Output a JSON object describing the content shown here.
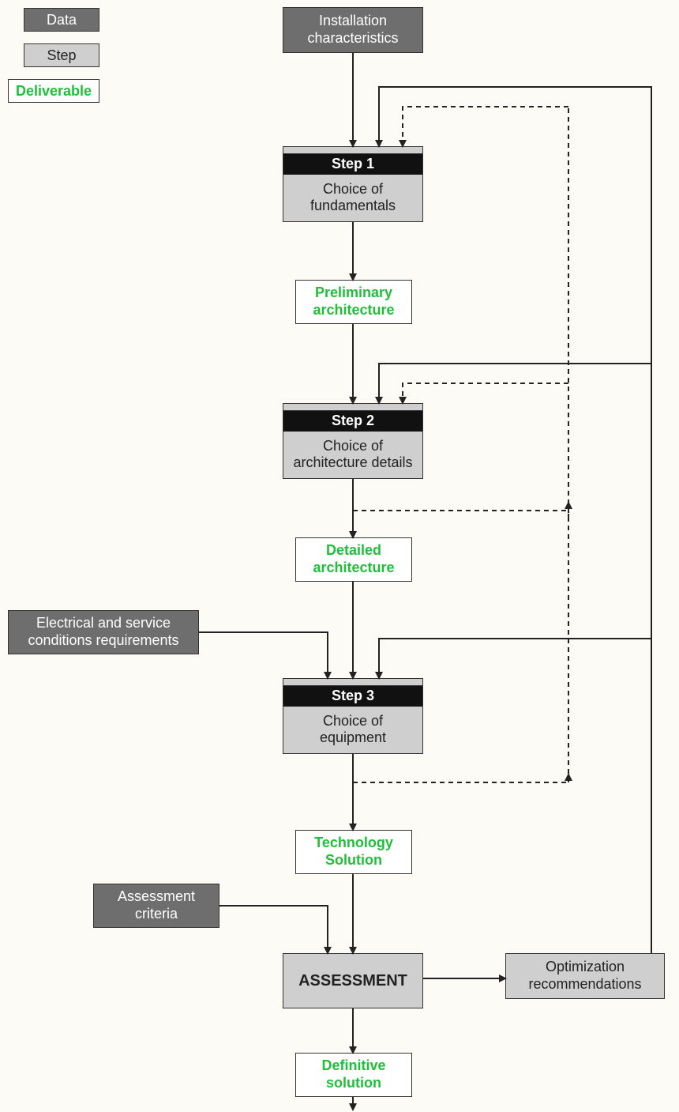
{
  "legend": {
    "data": "Data",
    "step": "Step",
    "deliverable": "Deliverable"
  },
  "nodes": {
    "installation": "Installation\ncharacteristics",
    "step1_title": "Step 1",
    "step1_body": "Choice of\nfundamentals",
    "prelim_arch": "Preliminary\narchitecture",
    "step2_title": "Step  2",
    "step2_body": "Choice of\narchitecture details",
    "detailed_arch": "Detailed\narchitecture",
    "elec_reqs": "Electrical and service\nconditions requirements",
    "step3_title": "Step  3",
    "step3_body": "Choice of\nequipment",
    "tech_solution": "Technology\nSolution",
    "assess_criteria": "Assessment\ncriteria",
    "assessment": "ASSESSMENT",
    "optim": "Optimization\nrecommendations",
    "definitive": "Definitive\nsolution"
  }
}
